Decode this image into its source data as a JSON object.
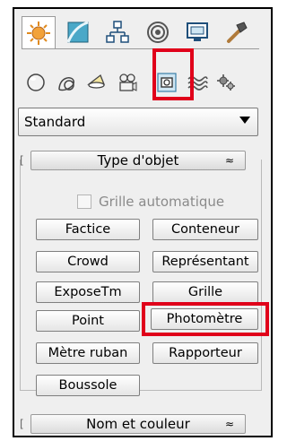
{
  "tabs": [
    {
      "icon": "create-icon",
      "active": true
    },
    {
      "icon": "modify-icon",
      "active": false
    },
    {
      "icon": "hierarchy-icon",
      "active": false
    },
    {
      "icon": "motion-icon",
      "active": false
    },
    {
      "icon": "display-icon",
      "active": false
    },
    {
      "icon": "utilities-icon",
      "active": false
    }
  ],
  "categories": [
    {
      "icon": "geometry-icon"
    },
    {
      "icon": "shapes-icon"
    },
    {
      "icon": "lights-icon"
    },
    {
      "icon": "cameras-icon"
    },
    {
      "icon": "helpers-icon",
      "selected": true
    },
    {
      "icon": "space-warps-icon"
    },
    {
      "icon": "systems-icon"
    }
  ],
  "dropdown": {
    "selected": "Standard"
  },
  "object_type": {
    "title": "Type d'objet",
    "collapse_symbol": "≈",
    "autogrid_label": "Grille automatique",
    "buttons": [
      "Factice",
      "Conteneur",
      "Crowd",
      "Représentant",
      "ExposeTm",
      "Grille",
      "Point",
      "Photomètre",
      "Mètre ruban",
      "Rapporteur",
      "Boussole"
    ]
  },
  "name_color": {
    "title": "Nom et couleur",
    "collapse_symbol": "≈"
  },
  "colors": {
    "highlight": "#e0001a"
  }
}
